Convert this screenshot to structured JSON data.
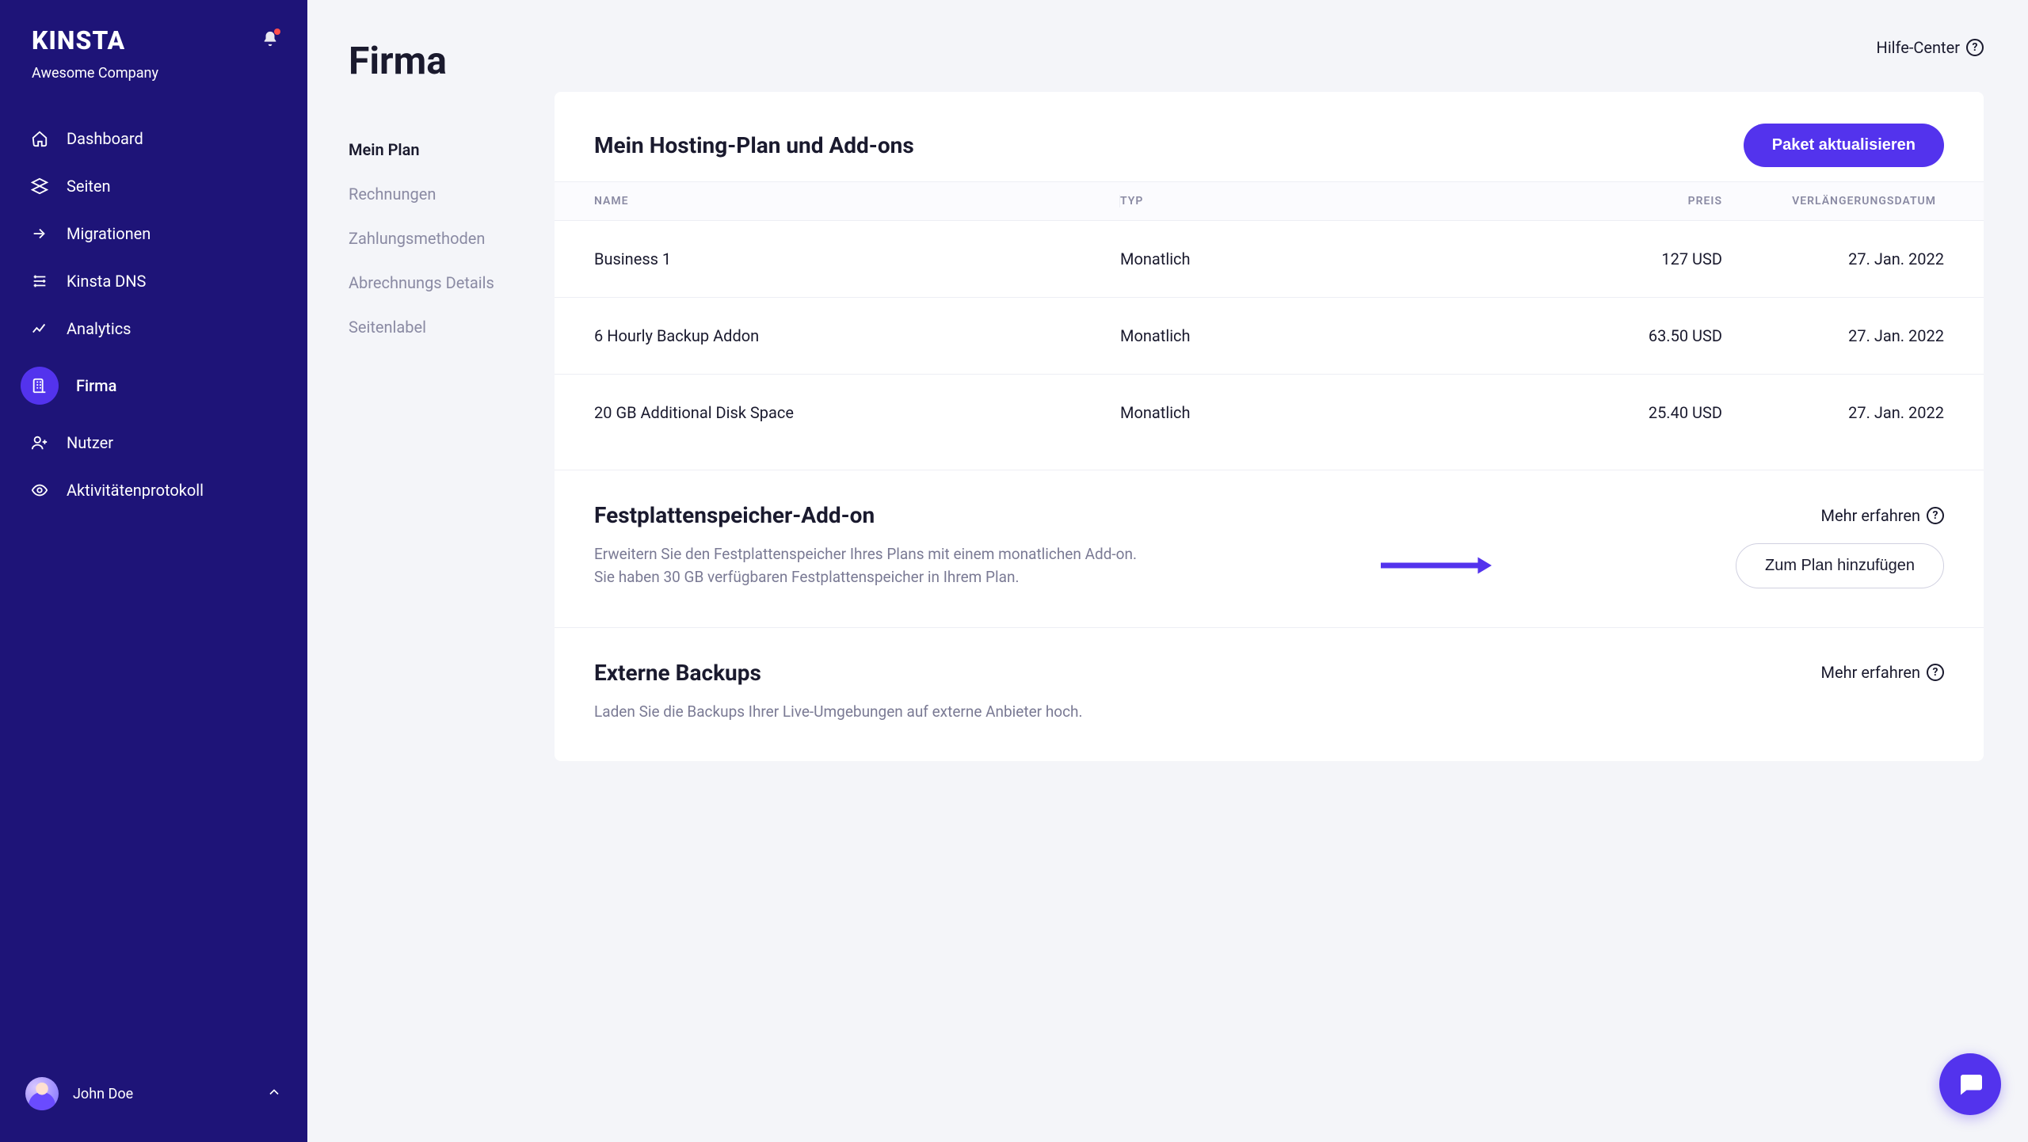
{
  "brand": "KINSTA",
  "company_name": "Awesome Company",
  "user_name": "John Doe",
  "sidebar": {
    "items": [
      {
        "label": "Dashboard"
      },
      {
        "label": "Seiten"
      },
      {
        "label": "Migrationen"
      },
      {
        "label": "Kinsta DNS"
      },
      {
        "label": "Analytics"
      },
      {
        "label": "Firma"
      },
      {
        "label": "Nutzer"
      },
      {
        "label": "Aktivitätenprotokoll"
      }
    ]
  },
  "page": {
    "title": "Firma"
  },
  "subnav": {
    "items": [
      {
        "label": "Mein Plan"
      },
      {
        "label": "Rechnungen"
      },
      {
        "label": "Zahlungsmethoden"
      },
      {
        "label": "Abrechnungs Details"
      },
      {
        "label": "Seitenlabel"
      }
    ]
  },
  "help": {
    "label": "Hilfe-Center"
  },
  "plan": {
    "title": "Mein Hosting-Plan und Add-ons",
    "update_btn": "Paket aktualisieren",
    "columns": {
      "name": "NAME",
      "type": "TYP",
      "price": "PREIS",
      "renews": "VERLÄNGERUNGSDATUM"
    },
    "rows": [
      {
        "name": "Business 1",
        "type": "Monatlich",
        "price": "127 USD",
        "renews": "27. Jan. 2022"
      },
      {
        "name": "6 Hourly Backup Addon",
        "type": "Monatlich",
        "price": "63.50 USD",
        "renews": "27. Jan. 2022"
      },
      {
        "name": "20 GB Additional Disk Space",
        "type": "Monatlich",
        "price": "25.40 USD",
        "renews": "27. Jan. 2022"
      }
    ]
  },
  "disk_addon": {
    "title": "Festplattenspeicher-Add-on",
    "learn_more": "Mehr erfahren",
    "desc1": "Erweitern Sie den Festplattenspeicher Ihres Plans mit einem monatlichen Add-on.",
    "desc2": "Sie haben 30 GB verfügbaren Festplattenspeicher in Ihrem Plan.",
    "add_btn": "Zum Plan hinzufügen"
  },
  "ext_backups": {
    "title": "Externe Backups",
    "learn_more": "Mehr erfahren",
    "desc": "Laden Sie die Backups Ihrer Live-Umgebungen auf externe Anbieter hoch."
  }
}
